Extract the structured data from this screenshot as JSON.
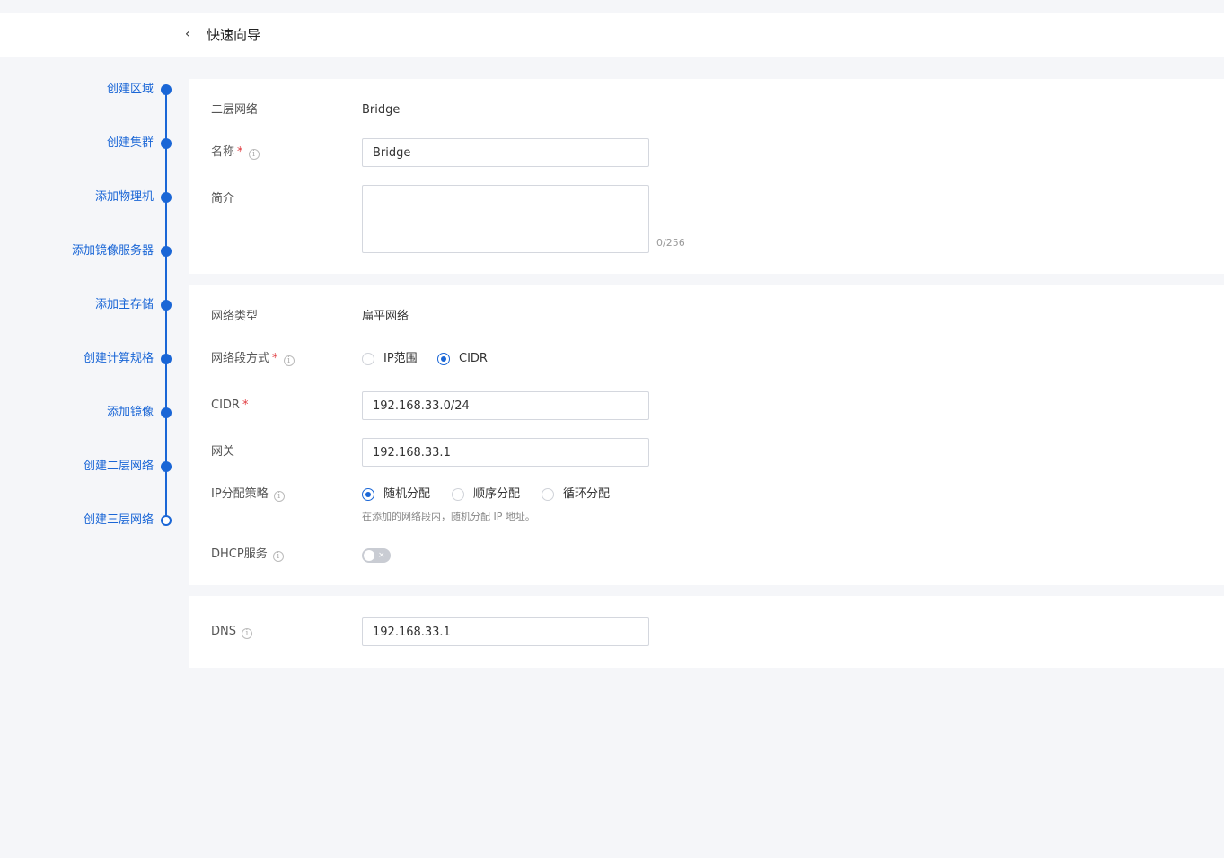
{
  "header": {
    "back_icon": "‹",
    "title": "快速向导"
  },
  "steps": [
    {
      "label": "创建区域",
      "state": "done"
    },
    {
      "label": "创建集群",
      "state": "done"
    },
    {
      "label": "添加物理机",
      "state": "done"
    },
    {
      "label": "添加镜像服务器",
      "state": "done"
    },
    {
      "label": "添加主存储",
      "state": "done"
    },
    {
      "label": "创建计算规格",
      "state": "done"
    },
    {
      "label": "添加镜像",
      "state": "done"
    },
    {
      "label": "创建二层网络",
      "state": "done"
    },
    {
      "label": "创建三层网络",
      "state": "current"
    }
  ],
  "section1": {
    "l2_label": "二层网络",
    "l2_value": "Bridge",
    "name_label": "名称",
    "required_mark": "*",
    "name_value": "Bridge",
    "desc_label": "简介",
    "desc_value": "",
    "desc_counter": "0/256"
  },
  "section2": {
    "nettype_label": "网络类型",
    "nettype_value": "扁平网络",
    "segment_label": "网络段方式",
    "segment_options": [
      "IP范围",
      "CIDR"
    ],
    "segment_selected": "CIDR",
    "cidr_label": "CIDR",
    "cidr_value": "192.168.33.0/24",
    "gateway_label": "网关",
    "gateway_value": "192.168.33.1",
    "ipalloc_label": "IP分配策略",
    "ipalloc_options": [
      "随机分配",
      "顺序分配",
      "循环分配"
    ],
    "ipalloc_selected": "随机分配",
    "ipalloc_hint": "在添加的网络段内，随机分配 IP 地址。",
    "dhcp_label": "DHCP服务",
    "dhcp_enabled": false,
    "toggle_off_mark": "×"
  },
  "section3": {
    "dns_label": "DNS",
    "dns_value": "192.168.33.1"
  },
  "info_icon_glyph": "i",
  "colors": {
    "accent": "#1a66d6",
    "required": "#e0393e",
    "background": "#f5f6f9"
  }
}
